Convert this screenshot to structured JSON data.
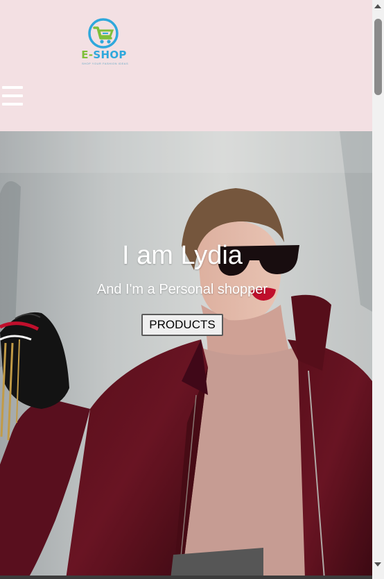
{
  "brand": {
    "name_prefix": "E-",
    "name_suffix": "SHOP",
    "tagline": "SHOP YOUR FASHION IDEAS",
    "colors": {
      "blue": "#2fa8dc",
      "green": "#7fbf3a"
    }
  },
  "header": {
    "background": "#f3e0e3",
    "menu_icon": "hamburger-menu-icon"
  },
  "hero": {
    "title": "I am Lydia",
    "subtitle": "And I'm a Personal shopper",
    "button_label": "PRODUCTS"
  },
  "scrollbar": {
    "position_fraction": 0
  }
}
